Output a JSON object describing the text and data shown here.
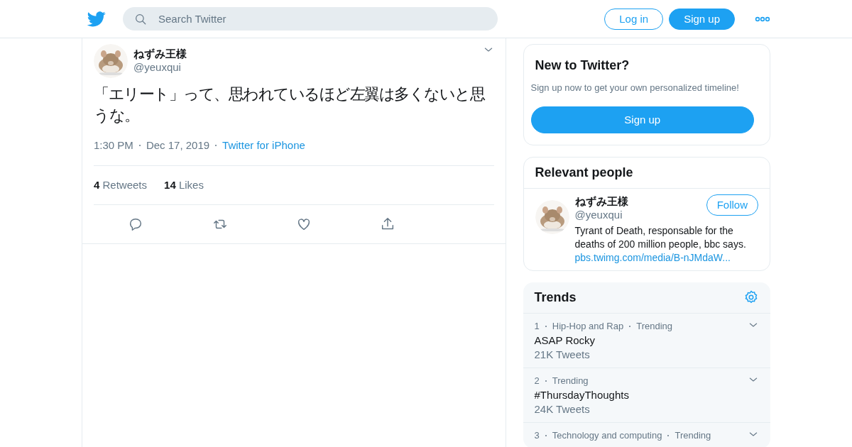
{
  "header": {
    "search": {
      "placeholder": "Search Twitter"
    },
    "buttons": [
      {
        "label": "Log in",
        "kind": "outline"
      },
      {
        "label": "Sign up",
        "kind": "solid"
      }
    ]
  },
  "tweet": {
    "author": {
      "name": "ねずみ王様",
      "handle": "@yeuxqui"
    },
    "text": "「エリート」って、思われているほど左翼は多くないと思うな。",
    "time": "1:30 PM",
    "date": "Dec 17, 2019",
    "source": "Twitter for iPhone",
    "stats": [
      {
        "count": "4",
        "label": "Retweets"
      },
      {
        "count": "14",
        "label": "Likes"
      }
    ]
  },
  "new_to_twitter": {
    "title": "New to Twitter?",
    "subtitle": "Sign up now to get your own personalized timeline!",
    "button": "Sign up"
  },
  "relevant_people": {
    "title": "Relevant people",
    "people": [
      {
        "name": "ねずみ王様",
        "handle": "@yeuxqui",
        "button": "Follow",
        "bio": "Tyrant of Death, responsable for the deaths of 200 million people, bbc says.",
        "link": "pbs.twimg.com/media/B-nJMdaW..."
      }
    ]
  },
  "trends": {
    "title": "Trends",
    "items": [
      {
        "rank": "1",
        "context": [
          "Hip-Hop and Rap",
          "Trending"
        ],
        "name": "ASAP Rocky",
        "count": "21K Tweets"
      },
      {
        "rank": "2",
        "context": [
          "Trending"
        ],
        "name": "#ThursdayThoughts",
        "count": "24K Tweets"
      },
      {
        "rank": "3",
        "context": [
          "Technology and computing",
          "Trending"
        ]
      }
    ]
  }
}
